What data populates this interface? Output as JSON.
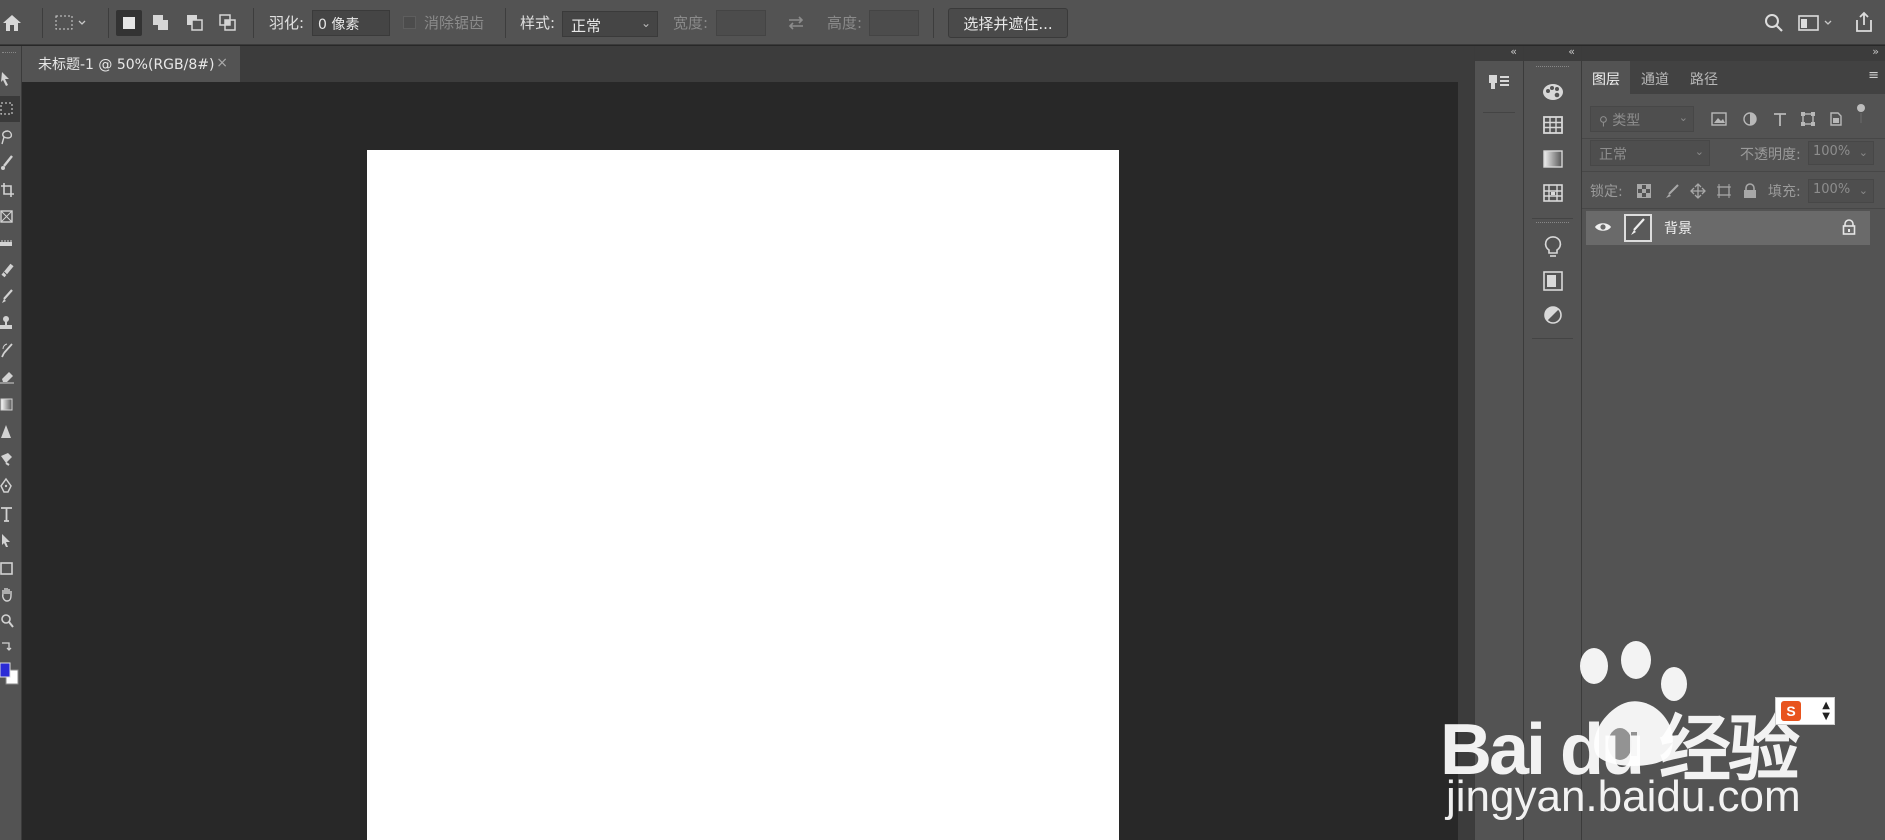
{
  "options_bar": {
    "feather_label": "羽化:",
    "feather_value": "0 像素",
    "antialias_label": "消除锯齿",
    "style_label": "样式:",
    "style_value": "正常",
    "width_label": "宽度:",
    "height_label": "高度:",
    "select_mask_button": "选择并遮住..."
  },
  "document_tab": {
    "title": "未标题-1 @ 50%(RGB/8#)",
    "close": "×"
  },
  "layers_panel": {
    "tabs": [
      "图层",
      "通道",
      "路径"
    ],
    "active_tab": "图层",
    "filter_kind": "类型",
    "blend_mode": "正常",
    "opacity_label": "不透明度:",
    "opacity_value": "100%",
    "lock_label": "锁定:",
    "fill_label": "填充:",
    "fill_value": "100%",
    "layers": [
      {
        "name": "背景",
        "visible": true,
        "locked": true
      }
    ]
  },
  "watermark": {
    "brand": "Bai  du 经验",
    "url": "jingyan.baidu.com"
  },
  "colors": {
    "chrome": "#535353",
    "canvas_bg": "#282828",
    "document": "#ffffff",
    "selected_layer": "#6a6a6a",
    "accent_foreground": "#2b2bd6"
  }
}
